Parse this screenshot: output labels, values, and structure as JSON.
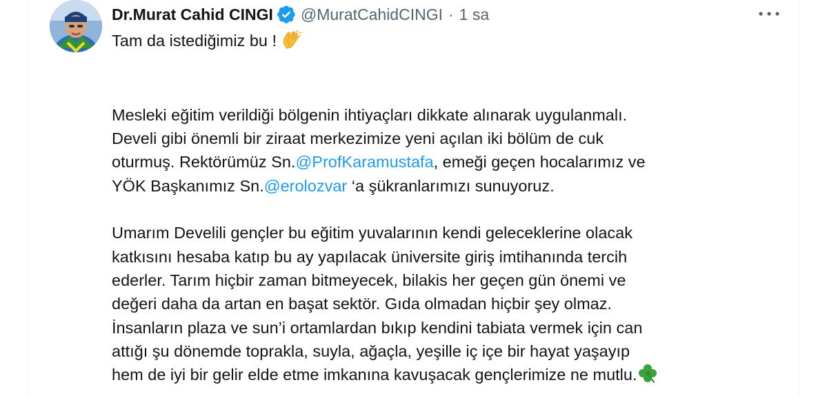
{
  "tweet": {
    "author": {
      "display_name": "Dr.Murat Cahid CINGI",
      "handle": "@MuratCahidCINGI",
      "verified": true,
      "avatar_icon": "profile-avatar"
    },
    "separator": "·",
    "time": "1 sa",
    "more_icon": "more-horizontal-icon",
    "lines": {
      "l1": "Tam da istediğimiz bu ! ",
      "l2": "Mesleki eğitim verildiği bölgenin ihtiyaçları dikkate alınarak uygulanmalı.",
      "l3": "Develi gibi önemli bir ziraat merkezimize yeni açılan iki bölüm de cuk",
      "l4a": "oturmuş. Rektörümüz Sn.",
      "l4_mention": "@ProfKaramustafa",
      "l4b": ", emeği geçen hocalarımız ve",
      "l5a": "YÖK Başkanımız Sn.",
      "l5_mention": "@erolozvar",
      "l5b": " ‘a şükranlarımızı sunuyoruz.",
      "l6": "Umarım Develili gençler bu eğitim yuvalarının kendi geleceklerine olacak",
      "l7": "katkısını hesaba katıp bu ay yapılacak üniversite giriş imtihanında tercih",
      "l8": "ederler.  Tarım hiçbir zaman bitmeyecek, bilakis her geçen gün önemi ve",
      "l9": "değeri daha da artan en başat sektör. Gıda olmadan hiçbir şey olmaz.",
      "l10": "İnsanların plaza ve sun’i ortamlardan bıkıp kendini tabiata vermek için can",
      "l11": "attığı şu dönemde toprakla, suyla, ağaçla, yeşille iç içe bir hayat yaşayıp",
      "l12": "hem de iyi bir gelir elde etme imkanına kavuşacak gençlerimize ne mutlu."
    },
    "emojis": {
      "clap": "clapping-hands-emoji",
      "shamrock": "shamrock-emoji"
    },
    "colors": {
      "link": "#1d9bf0",
      "verified": "#1d9bf0",
      "secondary_text": "#536471",
      "primary_text": "#0f1419"
    }
  }
}
